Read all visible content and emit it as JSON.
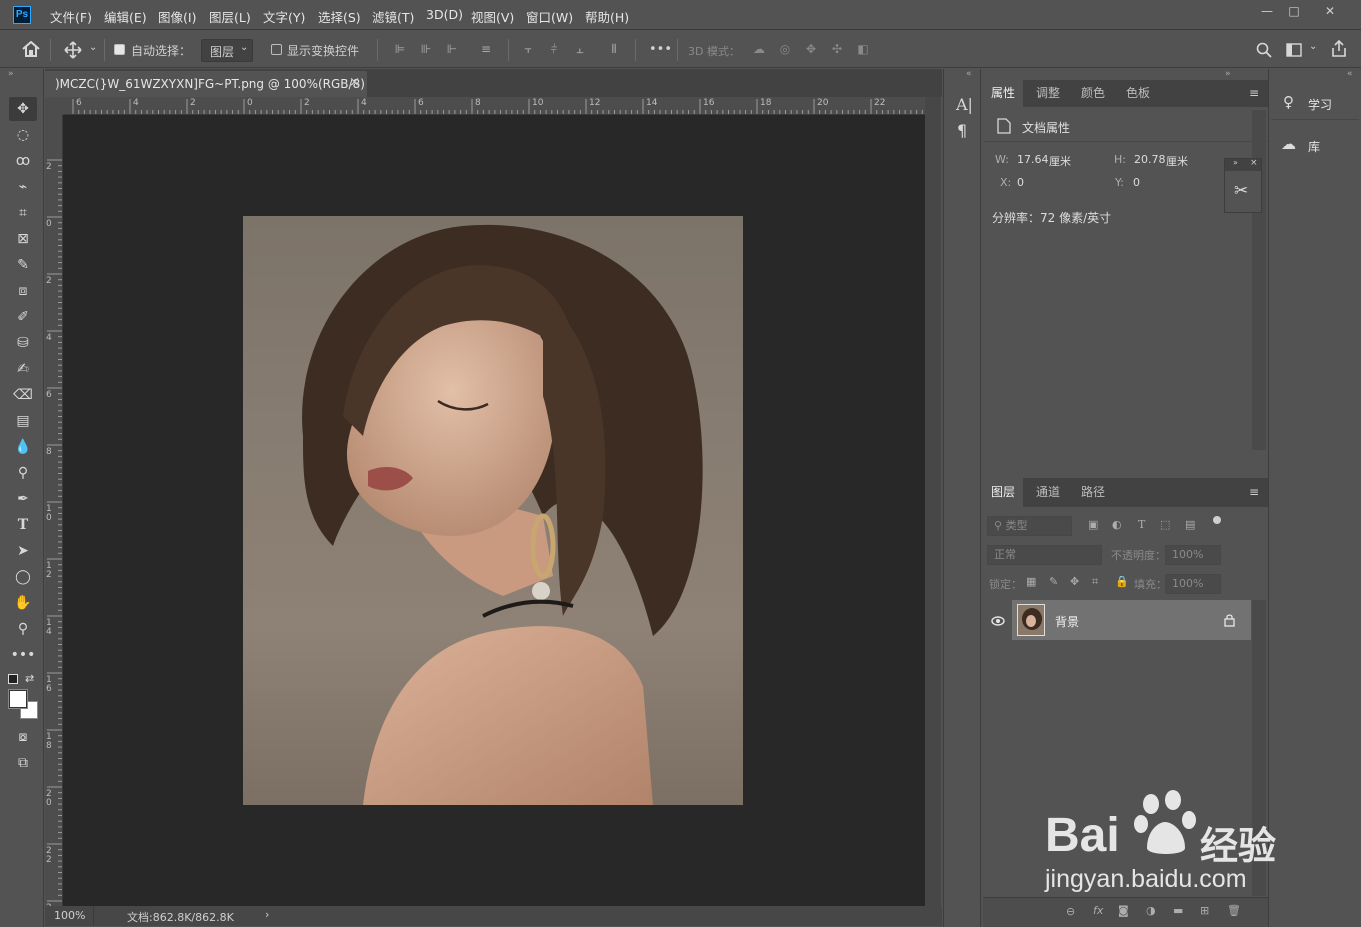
{
  "app": {
    "logo": "Ps"
  },
  "menu": [
    "文件(F)",
    "编辑(E)",
    "图像(I)",
    "图层(L)",
    "文字(Y)",
    "选择(S)",
    "滤镜(T)",
    "3D(D)",
    "视图(V)",
    "窗口(W)",
    "帮助(H)"
  ],
  "window_controls": {
    "minimize": "—",
    "maximize": "□",
    "close": "✕"
  },
  "options": {
    "auto_select_label": "自动选择：",
    "auto_select_checked": true,
    "auto_select_target": "图层",
    "show_transform_label": "显示变换控件",
    "show_transform_checked": false,
    "more": "•••",
    "mode_3d_label": "3D 模式："
  },
  "document": {
    "tab_title": ")MCZC(}W_61WZXYXN]FG~PT.png @ 100%(RGB/8) *",
    "close": "×",
    "zoom": "100%",
    "doc_info": "文档:862.8K/862.8K"
  },
  "rulers": {
    "h_labels": [
      "6",
      "4",
      "2",
      "0",
      "2",
      "4",
      "6",
      "8",
      "10",
      "12",
      "14",
      "16",
      "18",
      "20",
      "22"
    ],
    "v_labels": [
      "2",
      "0",
      "2",
      "4",
      "6",
      "8",
      "10",
      "12",
      "14",
      "16",
      "18",
      "20",
      "22",
      "2"
    ]
  },
  "properties": {
    "tabs": [
      "属性",
      "调整",
      "颜色",
      "色板"
    ],
    "active_tab": "属性",
    "section_title": "文档属性",
    "w_label": "W:",
    "w_value": "17.64",
    "w_unit": "厘米",
    "h_label": "H:",
    "h_value": "20.78",
    "h_unit": "厘米",
    "x_label": "X:",
    "x_value": "0",
    "y_label": "Y:",
    "y_value": "0",
    "resolution": "分辨率：72 像素/英寸"
  },
  "layers_panel": {
    "tabs": [
      "图层",
      "通道",
      "路径"
    ],
    "filter_placeholder": "类型",
    "blend_mode": "正常",
    "opacity_label": "不透明度：",
    "opacity_value": "100%",
    "lock_label": "锁定：",
    "fill_label": "填充：",
    "fill_value": "100%",
    "layers": [
      {
        "name": "背景",
        "visible": true,
        "locked": true
      }
    ],
    "bottom_icons": [
      "link-icon",
      "fx-icon",
      "mask-icon",
      "adjustment-icon",
      "folder-icon",
      "new-layer-icon",
      "trash-icon"
    ]
  },
  "side_panels": {
    "learn": "学习",
    "library": "库"
  },
  "watermark": {
    "brand": "Bai",
    "brand2": "经验",
    "url": "jingyan.baidu.com"
  },
  "colors": {
    "bg": "#535353",
    "canvas": "#282828",
    "dark": "#424242",
    "accent": "#31a8ff"
  }
}
